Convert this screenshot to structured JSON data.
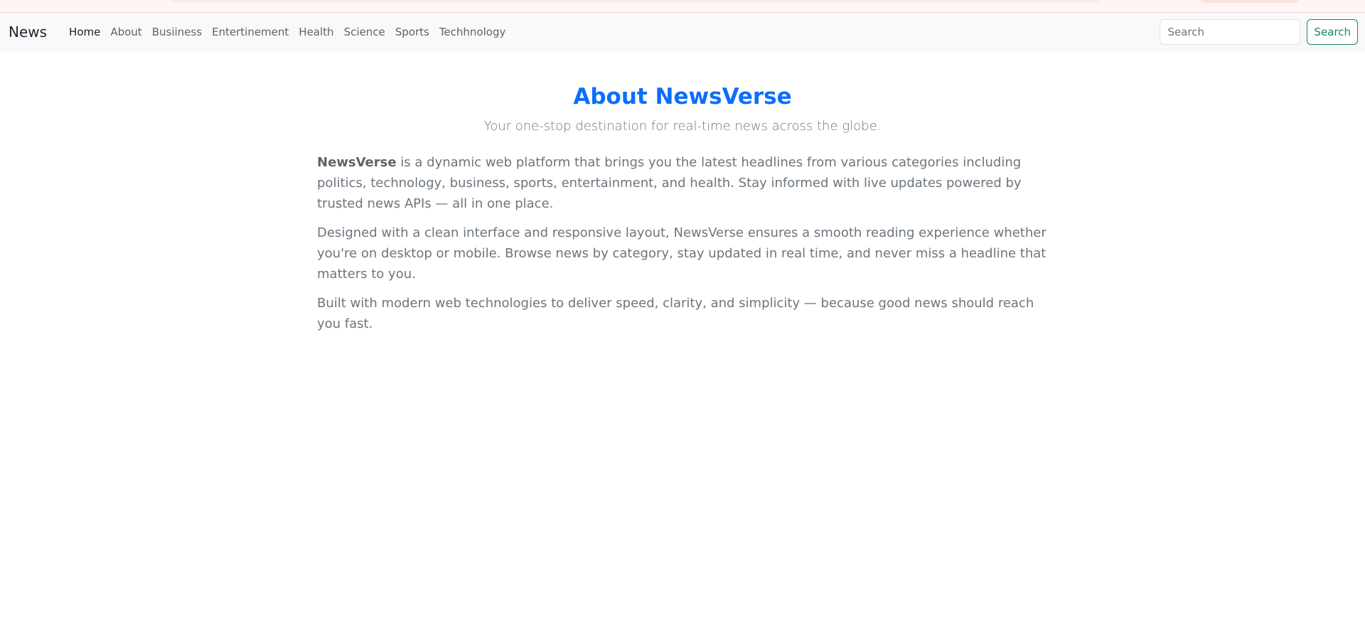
{
  "colors": {
    "title": "#0d6efd",
    "text_muted": "#6c757d",
    "navbar_bg": "#f8f9fa",
    "search_button": "#198754"
  },
  "navbar": {
    "brand": "News",
    "links": [
      {
        "label": "Home",
        "active": true
      },
      {
        "label": "About"
      },
      {
        "label": "Busiiness"
      },
      {
        "label": "Entertinement"
      },
      {
        "label": "Health"
      },
      {
        "label": "Science"
      },
      {
        "label": "Sports"
      },
      {
        "label": "Techhnology"
      }
    ],
    "search": {
      "placeholder": "Search",
      "value": "",
      "button_label": "Search"
    }
  },
  "about": {
    "title": "About NewsVerse",
    "subtitle": "Your one-stop destination for real-time news across the globe.",
    "paragraph1_bold": "NewsVerse",
    "paragraph1_rest": " is a dynamic web platform that brings you the latest headlines from various categories including politics, technology, business, sports, entertainment, and health. Stay informed with live updates powered by trusted news APIs — all in one place.",
    "paragraph2": "Designed with a clean interface and responsive layout, NewsVerse ensures a smooth reading experience whether you're on desktop or mobile. Browse news by category, stay updated in real time, and never miss a headline that matters to you.",
    "paragraph3": "Built with modern web technologies to deliver speed, clarity, and simplicity — because good news should reach you fast."
  }
}
